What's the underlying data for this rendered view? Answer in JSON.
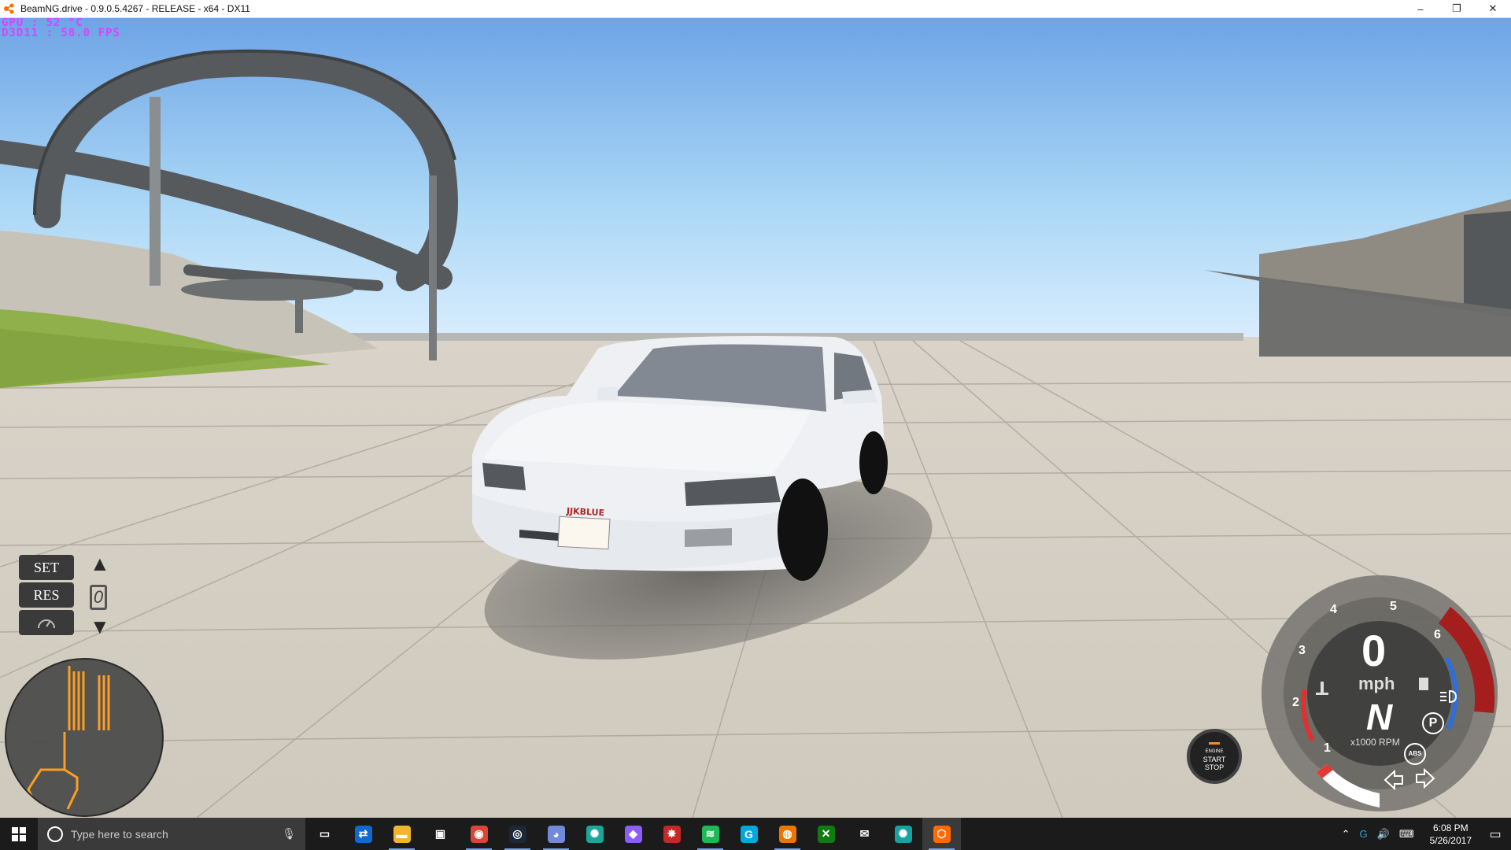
{
  "window": {
    "title": "BeamNG.drive - 0.9.0.5.4267 - RELEASE - x64 - DX11",
    "minimize": "–",
    "restore": "❐",
    "close": "✕"
  },
  "debug": {
    "line1": "GPU    : 52 °C",
    "line2": "D3D11  : 58.0 FPS"
  },
  "vehicle": {
    "plate": "JJKBLUE"
  },
  "cruise_control": {
    "set_label": "SET",
    "res_label": "RES",
    "speed": "0",
    "up_arrow": "▲",
    "down_arrow": "▼"
  },
  "engine_button": {
    "line1": "ENGINE",
    "line2": "START",
    "line3": "STOP"
  },
  "gauge": {
    "speed": "0",
    "unit": "mph",
    "gear": "N",
    "rpm_label": "x1000 RPM",
    "ticks": [
      "1",
      "2",
      "3",
      "4",
      "5",
      "6"
    ],
    "park_indicator": "P",
    "abs_indicator": "ABS"
  },
  "taskbar": {
    "search_placeholder": "Type here to search",
    "apps": [
      {
        "name": "task-view-icon",
        "glyph": "▭",
        "color": "#1b1b1b"
      },
      {
        "name": "teamviewer-icon",
        "glyph": "⇄",
        "color": "#0e6ad0"
      },
      {
        "name": "file-explorer-icon",
        "glyph": "▬",
        "color": "#f1b42f"
      },
      {
        "name": "store-icon",
        "glyph": "▣",
        "color": "#1b1b1b"
      },
      {
        "name": "chrome-icon",
        "glyph": "◉",
        "color": "#db4437"
      },
      {
        "name": "steam-icon",
        "glyph": "◎",
        "color": "#1b2838"
      },
      {
        "name": "discord-icon",
        "glyph": "◕",
        "color": "#7289da"
      },
      {
        "name": "app-teal-icon",
        "glyph": "✺",
        "color": "#1aa79a"
      },
      {
        "name": "maps-icon",
        "glyph": "◆",
        "color": "#8e5cf6"
      },
      {
        "name": "app-red-icon",
        "glyph": "✸",
        "color": "#c62828"
      },
      {
        "name": "spotify-icon",
        "glyph": "≋",
        "color": "#1db954"
      },
      {
        "name": "logitech-icon",
        "glyph": "G",
        "color": "#00a8e0"
      },
      {
        "name": "blender-icon",
        "glyph": "◍",
        "color": "#ea7600"
      },
      {
        "name": "xbox-icon",
        "glyph": "✕",
        "color": "#107c10"
      },
      {
        "name": "mail-icon",
        "glyph": "✉",
        "color": "#1b1b1b"
      },
      {
        "name": "app-teal2-icon",
        "glyph": "✺",
        "color": "#17a2a0"
      },
      {
        "name": "beamng-icon",
        "glyph": "⬡",
        "color": "#ff6a00"
      }
    ],
    "time": "6:08 PM",
    "date": "5/26/2017"
  }
}
